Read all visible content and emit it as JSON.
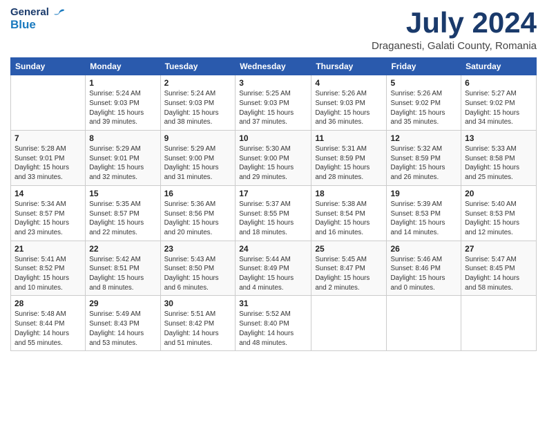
{
  "header": {
    "logo_line1": "General",
    "logo_line2": "Blue",
    "month_year": "July 2024",
    "location": "Draganesti, Galati County, Romania"
  },
  "weekdays": [
    "Sunday",
    "Monday",
    "Tuesday",
    "Wednesday",
    "Thursday",
    "Friday",
    "Saturday"
  ],
  "weeks": [
    [
      {
        "day": "",
        "info": ""
      },
      {
        "day": "1",
        "info": "Sunrise: 5:24 AM\nSunset: 9:03 PM\nDaylight: 15 hours\nand 39 minutes."
      },
      {
        "day": "2",
        "info": "Sunrise: 5:24 AM\nSunset: 9:03 PM\nDaylight: 15 hours\nand 38 minutes."
      },
      {
        "day": "3",
        "info": "Sunrise: 5:25 AM\nSunset: 9:03 PM\nDaylight: 15 hours\nand 37 minutes."
      },
      {
        "day": "4",
        "info": "Sunrise: 5:26 AM\nSunset: 9:03 PM\nDaylight: 15 hours\nand 36 minutes."
      },
      {
        "day": "5",
        "info": "Sunrise: 5:26 AM\nSunset: 9:02 PM\nDaylight: 15 hours\nand 35 minutes."
      },
      {
        "day": "6",
        "info": "Sunrise: 5:27 AM\nSunset: 9:02 PM\nDaylight: 15 hours\nand 34 minutes."
      }
    ],
    [
      {
        "day": "7",
        "info": "Sunrise: 5:28 AM\nSunset: 9:01 PM\nDaylight: 15 hours\nand 33 minutes."
      },
      {
        "day": "8",
        "info": "Sunrise: 5:29 AM\nSunset: 9:01 PM\nDaylight: 15 hours\nand 32 minutes."
      },
      {
        "day": "9",
        "info": "Sunrise: 5:29 AM\nSunset: 9:00 PM\nDaylight: 15 hours\nand 31 minutes."
      },
      {
        "day": "10",
        "info": "Sunrise: 5:30 AM\nSunset: 9:00 PM\nDaylight: 15 hours\nand 29 minutes."
      },
      {
        "day": "11",
        "info": "Sunrise: 5:31 AM\nSunset: 8:59 PM\nDaylight: 15 hours\nand 28 minutes."
      },
      {
        "day": "12",
        "info": "Sunrise: 5:32 AM\nSunset: 8:59 PM\nDaylight: 15 hours\nand 26 minutes."
      },
      {
        "day": "13",
        "info": "Sunrise: 5:33 AM\nSunset: 8:58 PM\nDaylight: 15 hours\nand 25 minutes."
      }
    ],
    [
      {
        "day": "14",
        "info": "Sunrise: 5:34 AM\nSunset: 8:57 PM\nDaylight: 15 hours\nand 23 minutes."
      },
      {
        "day": "15",
        "info": "Sunrise: 5:35 AM\nSunset: 8:57 PM\nDaylight: 15 hours\nand 22 minutes."
      },
      {
        "day": "16",
        "info": "Sunrise: 5:36 AM\nSunset: 8:56 PM\nDaylight: 15 hours\nand 20 minutes."
      },
      {
        "day": "17",
        "info": "Sunrise: 5:37 AM\nSunset: 8:55 PM\nDaylight: 15 hours\nand 18 minutes."
      },
      {
        "day": "18",
        "info": "Sunrise: 5:38 AM\nSunset: 8:54 PM\nDaylight: 15 hours\nand 16 minutes."
      },
      {
        "day": "19",
        "info": "Sunrise: 5:39 AM\nSunset: 8:53 PM\nDaylight: 15 hours\nand 14 minutes."
      },
      {
        "day": "20",
        "info": "Sunrise: 5:40 AM\nSunset: 8:53 PM\nDaylight: 15 hours\nand 12 minutes."
      }
    ],
    [
      {
        "day": "21",
        "info": "Sunrise: 5:41 AM\nSunset: 8:52 PM\nDaylight: 15 hours\nand 10 minutes."
      },
      {
        "day": "22",
        "info": "Sunrise: 5:42 AM\nSunset: 8:51 PM\nDaylight: 15 hours\nand 8 minutes."
      },
      {
        "day": "23",
        "info": "Sunrise: 5:43 AM\nSunset: 8:50 PM\nDaylight: 15 hours\nand 6 minutes."
      },
      {
        "day": "24",
        "info": "Sunrise: 5:44 AM\nSunset: 8:49 PM\nDaylight: 15 hours\nand 4 minutes."
      },
      {
        "day": "25",
        "info": "Sunrise: 5:45 AM\nSunset: 8:47 PM\nDaylight: 15 hours\nand 2 minutes."
      },
      {
        "day": "26",
        "info": "Sunrise: 5:46 AM\nSunset: 8:46 PM\nDaylight: 15 hours\nand 0 minutes."
      },
      {
        "day": "27",
        "info": "Sunrise: 5:47 AM\nSunset: 8:45 PM\nDaylight: 14 hours\nand 58 minutes."
      }
    ],
    [
      {
        "day": "28",
        "info": "Sunrise: 5:48 AM\nSunset: 8:44 PM\nDaylight: 14 hours\nand 55 minutes."
      },
      {
        "day": "29",
        "info": "Sunrise: 5:49 AM\nSunset: 8:43 PM\nDaylight: 14 hours\nand 53 minutes."
      },
      {
        "day": "30",
        "info": "Sunrise: 5:51 AM\nSunset: 8:42 PM\nDaylight: 14 hours\nand 51 minutes."
      },
      {
        "day": "31",
        "info": "Sunrise: 5:52 AM\nSunset: 8:40 PM\nDaylight: 14 hours\nand 48 minutes."
      },
      {
        "day": "",
        "info": ""
      },
      {
        "day": "",
        "info": ""
      },
      {
        "day": "",
        "info": ""
      }
    ]
  ]
}
